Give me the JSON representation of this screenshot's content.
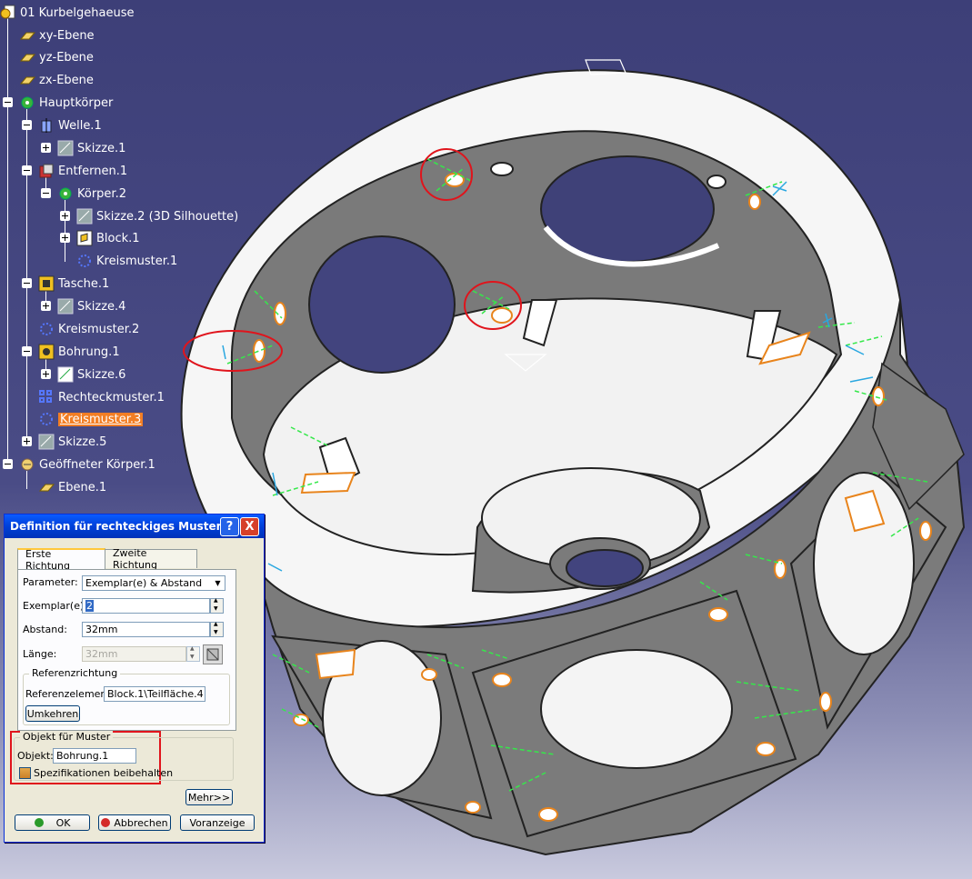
{
  "tree": {
    "root": "01 Kurbelgehaeuse",
    "items": [
      {
        "label": "xy-Ebene"
      },
      {
        "label": "yz-Ebene"
      },
      {
        "label": "zx-Ebene"
      },
      {
        "label": "Hauptkörper"
      },
      {
        "label": "Welle.1"
      },
      {
        "label": "Skizze.1"
      },
      {
        "label": "Entfernen.1"
      },
      {
        "label": "Körper.2"
      },
      {
        "label": "Skizze.2 (3D Silhouette)"
      },
      {
        "label": "Block.1"
      },
      {
        "label": "Kreismuster.1"
      },
      {
        "label": "Tasche.1"
      },
      {
        "label": "Skizze.4"
      },
      {
        "label": "Kreismuster.2"
      },
      {
        "label": "Bohrung.1"
      },
      {
        "label": "Skizze.6"
      },
      {
        "label": "Rechteckmuster.1"
      },
      {
        "label": "Kreismuster.3"
      },
      {
        "label": "Skizze.5"
      },
      {
        "label": "Geöffneter Körper.1"
      },
      {
        "label": "Ebene.1"
      }
    ]
  },
  "dialog": {
    "title": "Definition für rechteckiges Muster",
    "help_label": "?",
    "close_label": "X",
    "tabs": [
      {
        "label": "Erste Richtung"
      },
      {
        "label": "Zweite Richtung"
      }
    ],
    "parameter_label": "Parameter:",
    "parameter_value": "Exemplar(e) & Abstand",
    "exemplare_label": "Exemplar(e):",
    "exemplare_value": "2",
    "abstand_label": "Abstand:",
    "abstand_value": "32mm",
    "laenge_label": "Länge:",
    "laenge_value": "32mm",
    "ref_group_title": "Referenzrichtung",
    "ref_label": "Referenzelement:",
    "ref_value": "Block.1\\Teilfläche.4",
    "umkehren_label": "Umkehren",
    "obj_group_title": "Objekt für Muster",
    "objekt_label": "Objekt:",
    "objekt_value": "Bohrung.1",
    "spec_label": "Spezifikationen beibehalten",
    "mehr_label": "Mehr>>",
    "ok_label": "OK",
    "abbrechen_label": "Abbrechen",
    "voranzeige_label": "Voranzeige"
  },
  "colors": {
    "background": "#42447e",
    "selection": "#f27e24",
    "annotation_red": "#e0141c",
    "sketch_green": "#35e84a",
    "sketch_cyan": "#2aa7e0",
    "part_dark": "#7b7b7b",
    "part_light": "#f4f4f4"
  }
}
